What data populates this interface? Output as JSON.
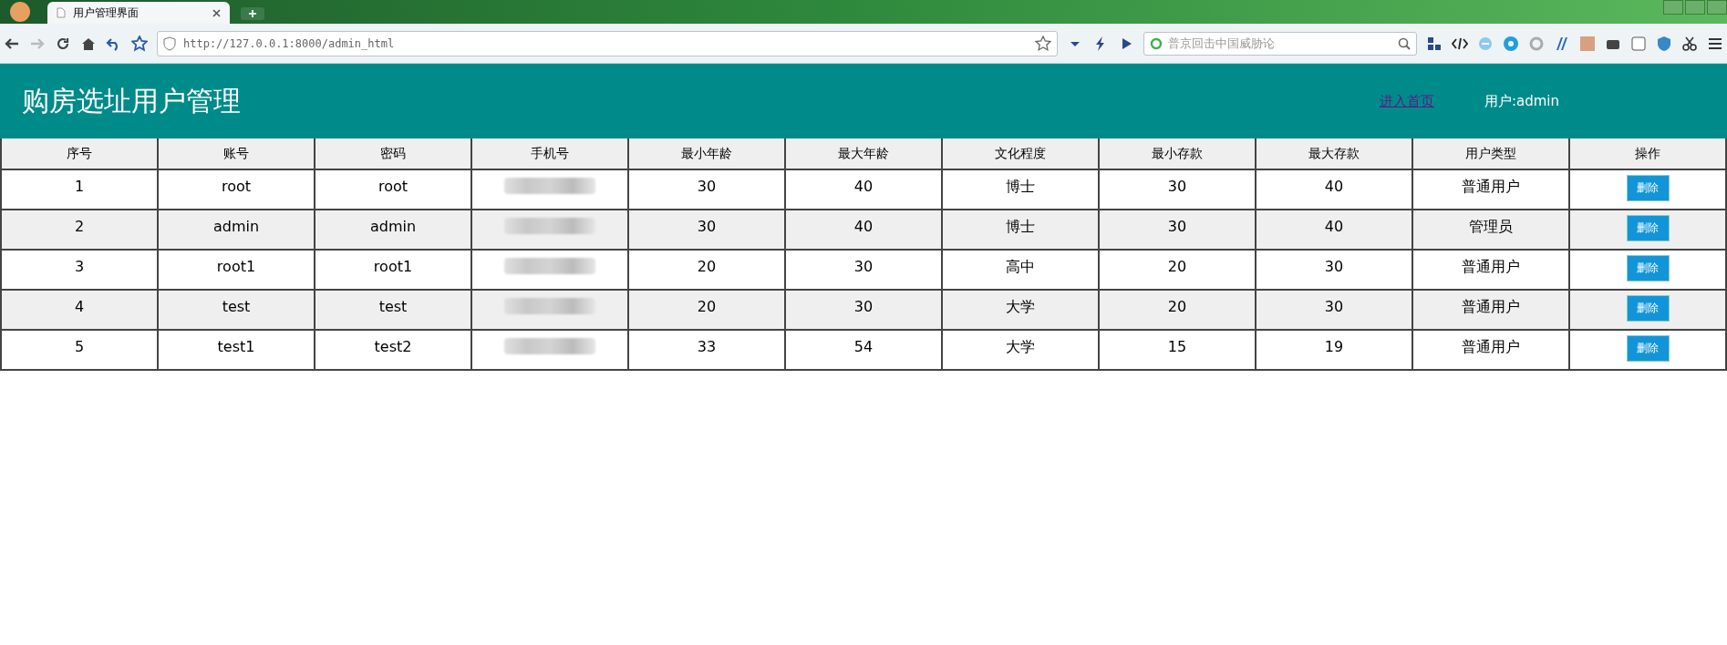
{
  "browser": {
    "tab_title": "用户管理界面",
    "url": "http://127.0.0.1:8000/admin_html",
    "search_placeholder": "普京回击中国威胁论"
  },
  "header": {
    "title": "购房选址用户管理",
    "home_link": "进入首页",
    "user": "用户:admin"
  },
  "table": {
    "columns": [
      "序号",
      "账号",
      "密码",
      "手机号",
      "最小年龄",
      "最大年龄",
      "文化程度",
      "最小存款",
      "最大存款",
      "用户类型",
      "操作"
    ],
    "rows": [
      {
        "cells": [
          "1",
          "root",
          "root",
          "",
          "30",
          "40",
          "博士",
          "30",
          "40",
          "普通用户"
        ],
        "action": "删除"
      },
      {
        "cells": [
          "2",
          "admin",
          "admin",
          "",
          "30",
          "40",
          "博士",
          "30",
          "40",
          "管理员"
        ],
        "action": "删除"
      },
      {
        "cells": [
          "3",
          "root1",
          "root1",
          "",
          "20",
          "30",
          "高中",
          "20",
          "30",
          "普通用户"
        ],
        "action": "删除"
      },
      {
        "cells": [
          "4",
          "test",
          "test",
          "",
          "20",
          "30",
          "大学",
          "20",
          "30",
          "普通用户"
        ],
        "action": "删除"
      },
      {
        "cells": [
          "5",
          "test1",
          "test2",
          "",
          "33",
          "54",
          "大学",
          "15",
          "19",
          "普通用户"
        ],
        "action": "删除"
      }
    ]
  }
}
